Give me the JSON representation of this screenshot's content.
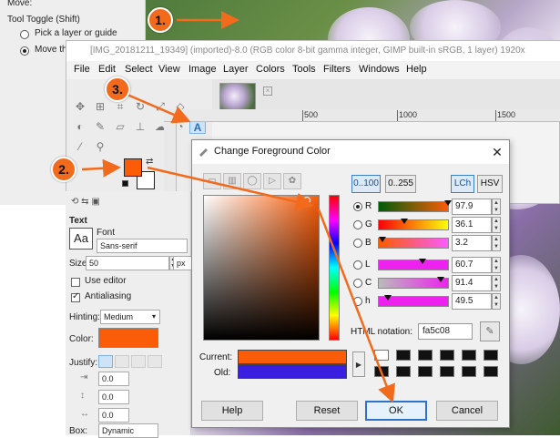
{
  "background": {
    "accent": "#f26a1b",
    "fg_color": "#fa5c08",
    "old_color": "#3a1fe0"
  },
  "options_top": {
    "move_label": "Move:",
    "tool_toggle": "Tool Toggle  (Shift)",
    "opt1": "Pick a layer or guide",
    "opt2": "Move th"
  },
  "gimp": {
    "title": "[IMG_20181211_19349] (imported)-8.0 (RGB color 8-bit gamma integer, GIMP built-in sRGB, 1 layer) 1920x",
    "menu": [
      "File",
      "Edit",
      "Select",
      "View",
      "Image",
      "Layer",
      "Colors",
      "Tools",
      "Filters",
      "Windows",
      "Help"
    ],
    "ruler": [
      "500",
      "1000",
      "1500"
    ]
  },
  "tool_options": {
    "section": "Text",
    "font_label": "Font",
    "font_value": "Sans-serif",
    "aa_icon": "Aa",
    "size_label": "Size:",
    "size_value": "50",
    "size_unit": "px",
    "use_editor": "Use editor",
    "antialiasing": "Antialiasing",
    "hinting_label": "Hinting:",
    "hinting_value": "Medium",
    "color_label": "Color:",
    "justify_label": "Justify:",
    "indent_value": "0.0",
    "line_value": "0.0",
    "letter_value": "0.0",
    "box_label": "Box:",
    "box_value": "Dynamic"
  },
  "dialog": {
    "title": "Change Foreground Color",
    "range_100": "0..100",
    "range_255": "0..255",
    "lch": "LCh",
    "hsv": "HSV",
    "channels": [
      {
        "label": "R",
        "value": "97.9",
        "selected": true
      },
      {
        "label": "G",
        "value": "36.1",
        "selected": false
      },
      {
        "label": "B",
        "value": "3.2",
        "selected": false
      },
      {
        "label": "L",
        "value": "60.7",
        "selected": false
      },
      {
        "label": "C",
        "value": "91.4",
        "selected": false
      },
      {
        "label": "h",
        "value": "49.5",
        "selected": false
      }
    ],
    "html_label": "HTML notation:",
    "html_value": "fa5c08",
    "current_label": "Current:",
    "old_label": "Old:",
    "buttons": {
      "help": "Help",
      "reset": "Reset",
      "ok": "OK",
      "cancel": "Cancel"
    }
  },
  "callouts": [
    "1.",
    "2.",
    "3."
  ]
}
